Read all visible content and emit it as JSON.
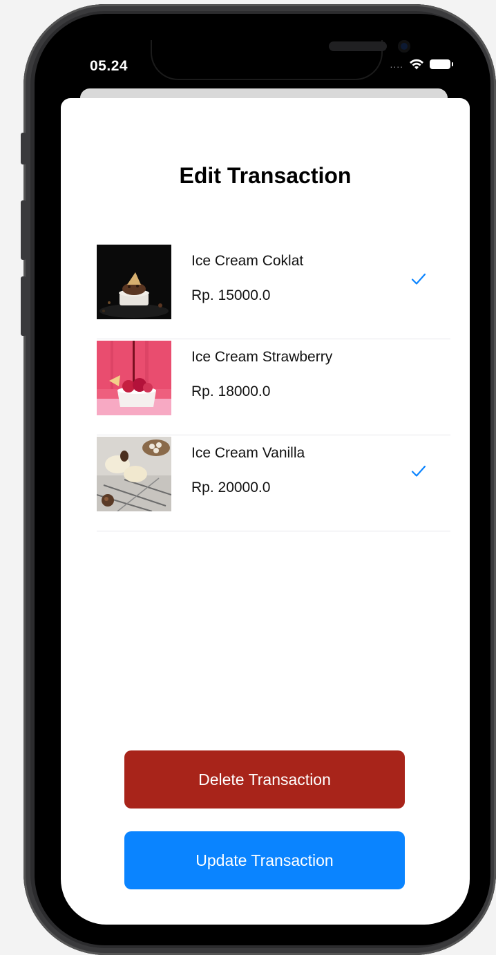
{
  "status_bar": {
    "time": "05.24",
    "signal": "....",
    "wifi_icon": "wifi-icon",
    "battery_icon": "battery-icon"
  },
  "screen": {
    "title": "Edit Transaction"
  },
  "items": [
    {
      "name": "Ice Cream Coklat",
      "price": "Rp. 15000.0",
      "selected": true,
      "image": "chocolate-ice-cream-photo"
    },
    {
      "name": "Ice Cream Strawberry",
      "price": "Rp. 18000.0",
      "selected": false,
      "image": "strawberry-ice-cream-photo"
    },
    {
      "name": "Ice Cream Vanilla",
      "price": "Rp. 20000.0",
      "selected": true,
      "image": "vanilla-ice-cream-photo"
    }
  ],
  "actions": {
    "delete_label": "Delete Transaction",
    "update_label": "Update Transaction"
  },
  "colors": {
    "delete": "#a8241a",
    "update": "#0a84ff",
    "checkmark": "#0a84ff"
  }
}
